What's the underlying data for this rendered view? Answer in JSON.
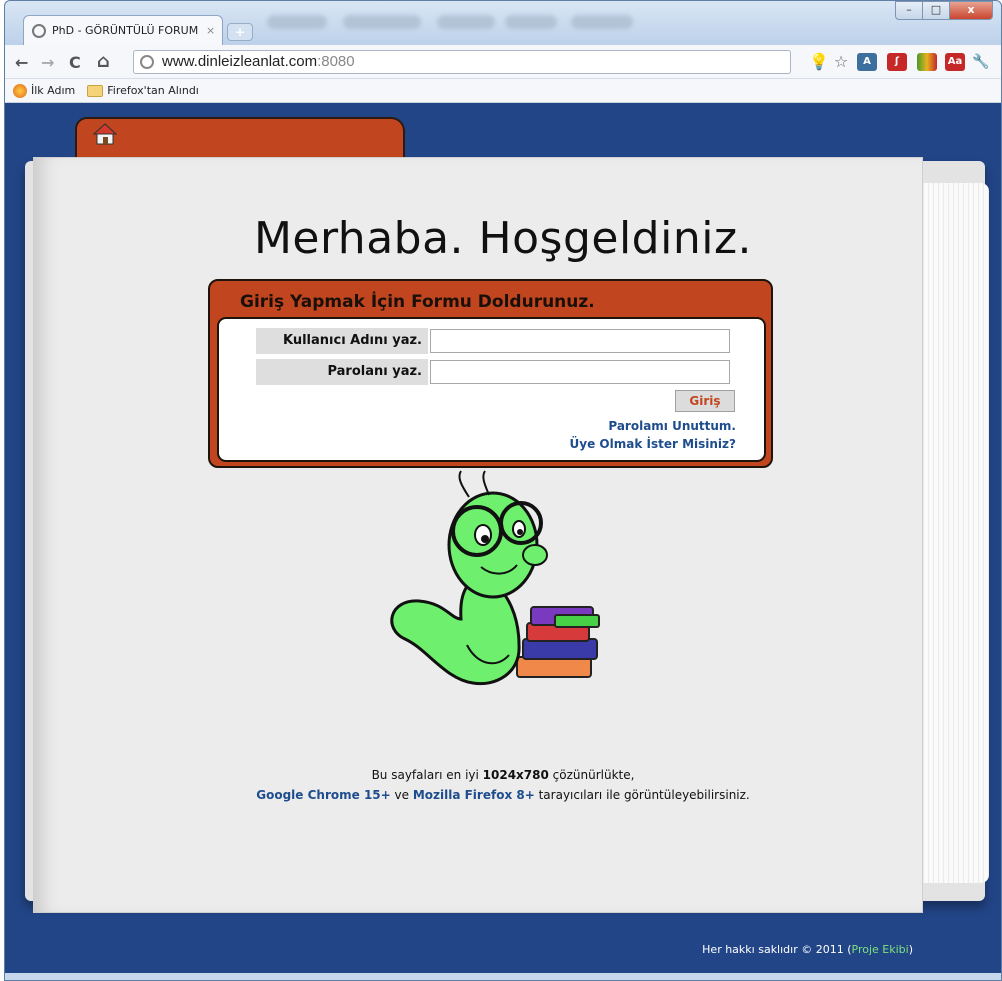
{
  "browser": {
    "tab_title": "PhD - GÖRÜNTÜLÜ FORUM",
    "tab_close": "×",
    "new_tab": "+",
    "window_buttons": {
      "minimize": "–",
      "maximize": "□",
      "close": "x"
    },
    "nav": {
      "back": "←",
      "forward": "→",
      "reload": "C",
      "home": "⌂"
    },
    "url_host": "www.dinleizleanlat.com",
    "url_port": ":8080",
    "extensions": [
      {
        "name": "lightbulb-icon",
        "color": "#777777"
      },
      {
        "name": "star-icon",
        "color": "#888888"
      },
      {
        "name": "translate-icon",
        "color": "#3c6e9e"
      },
      {
        "name": "pdf-icon",
        "color": "#c62828"
      },
      {
        "name": "chart-ext-icon",
        "color": "#4a9a2a"
      },
      {
        "name": "dictionary-icon",
        "color": "#c62828"
      },
      {
        "name": "wrench-icon",
        "color": "#555555"
      }
    ],
    "bookmarks": [
      "İlk Adım",
      "Firefox'tan Alındı"
    ]
  },
  "site": {
    "welcome": "Merhaba. Hoşgeldiniz.",
    "form_title": "Giriş Yapmak İçin Formu Doldurunuz.",
    "username_label": "Kullanıcı Adını yaz.",
    "username_value": "",
    "password_label": "Parolanı yaz.",
    "password_value": "",
    "submit_label": "Giriş",
    "forgot_link": "Parolamı Unuttum.",
    "register_link": "Üye Olmak İster Misiniz?",
    "footer": {
      "line1_pre": "Bu sayfaları en iyi ",
      "resolution": "1024x780",
      "line1_post": " çözünürlükte,",
      "chrome": "Google Chrome 15+",
      "ve": " ve ",
      "firefox": "Mozilla Firefox 8+",
      "line2_post": " tarayıcıları ile görüntüleyebilirsiniz."
    },
    "copyright_pre": "Her hakkı saklıdır © 2011 (",
    "copyright_team": "Proje Ekibi",
    "copyright_post": ")"
  },
  "colors": {
    "page_bg": "#224587",
    "accent": "#c1461f",
    "link": "#1e4d8e",
    "team_link": "#7ee07e"
  }
}
